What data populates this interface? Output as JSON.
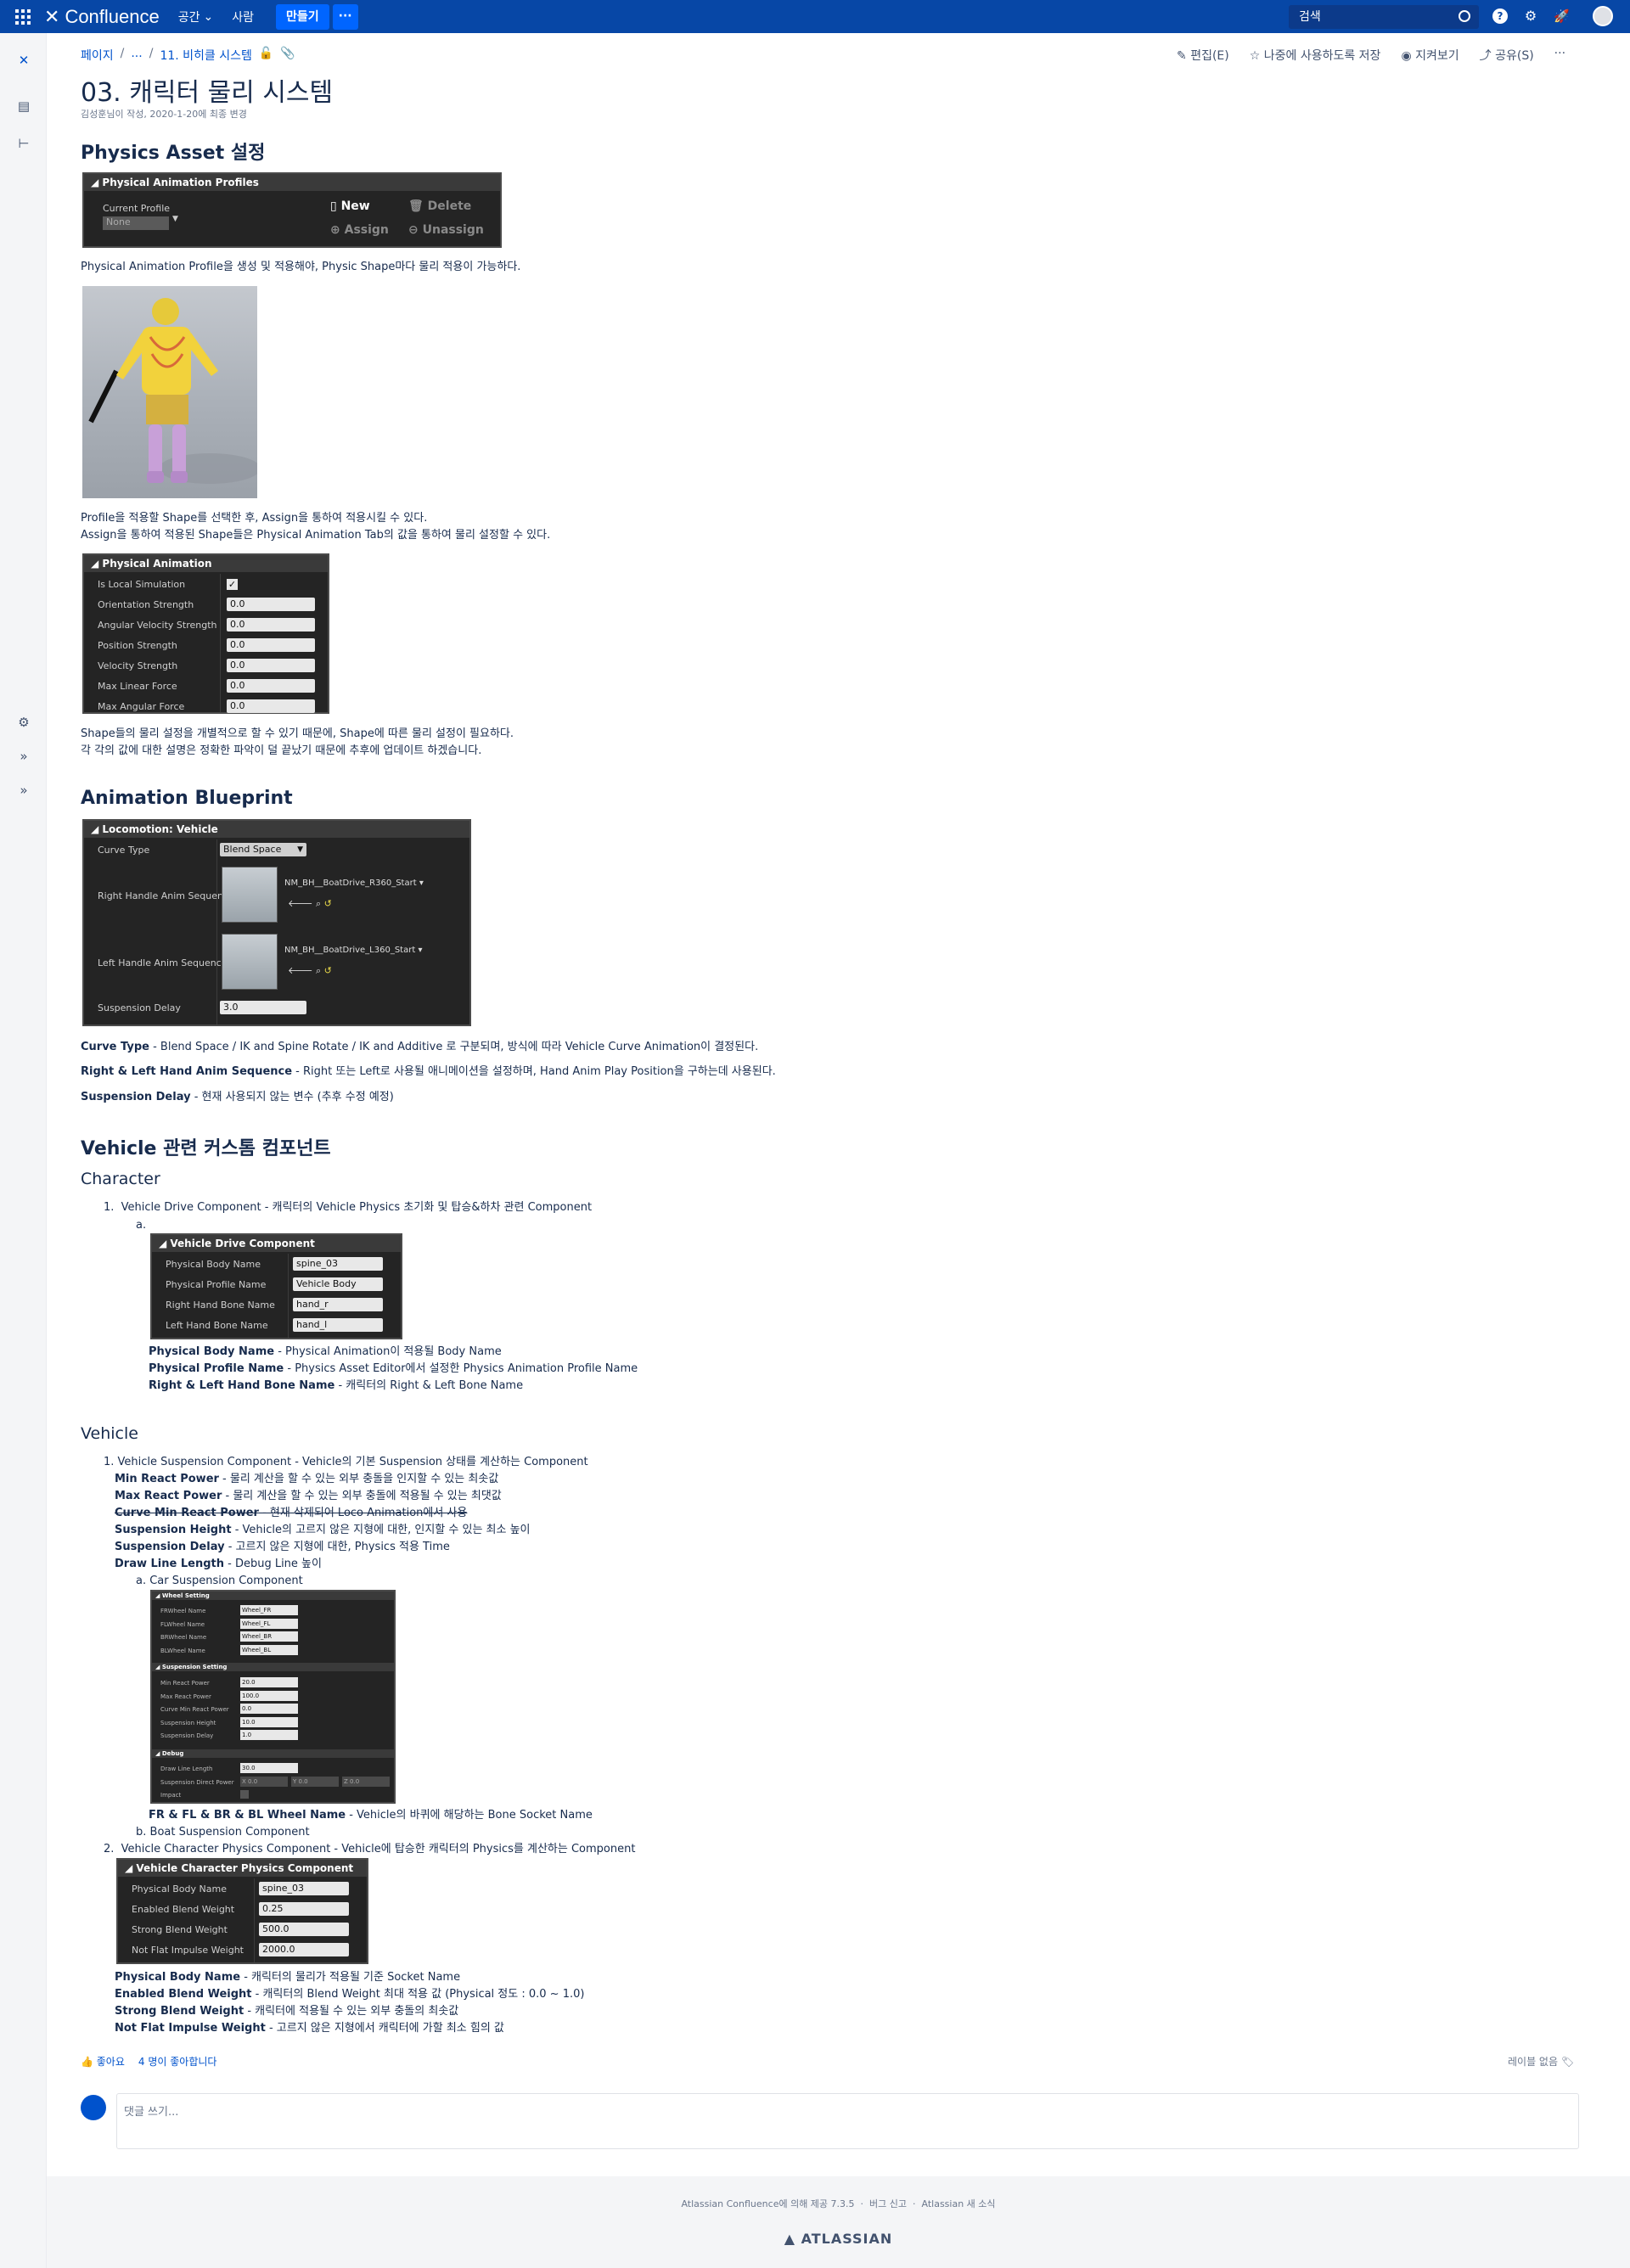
{
  "topnav": {
    "logo": "Confluence",
    "spaces": "공간",
    "people": "사람",
    "create": "만들기",
    "more": "···",
    "search_placeholder": "검색"
  },
  "breadcrumb": {
    "root": "페이지",
    "ellipsis": "...",
    "parent": "11. 비히클 시스템"
  },
  "actions": {
    "edit": "편집(E)",
    "save_later": "나중에 사용하도록 저장",
    "watch": "지켜보기",
    "share": "공유(S)",
    "more": "···"
  },
  "page": {
    "title": "03. 캐릭터 물리 시스템",
    "byline": "김성훈님이 작성, 2020-1-20에 최종 변경"
  },
  "sections": {
    "physics_asset": {
      "heading": "Physics Asset 설정",
      "profiles_panel": {
        "title": "Physical Animation Profiles",
        "current_profile_label": "Current Profile",
        "current_profile_value": "None",
        "new": "New",
        "delete": "Delete",
        "assign": "Assign",
        "unassign": "Unassign"
      },
      "text1": "Physical Animation Profile을 생성 및 적용해야, Physic Shape마다 물리 적용이 가능하다.",
      "text2": "Profile을 적용할 Shape를 선택한 후, Assign을 통하여 적용시킬 수 있다.",
      "text3": "Assign을 통하여 적용된 Shape들은 Physical Animation Tab의 값을 통하여 물리 설정할 수 있다.",
      "pa_panel": {
        "title": "Physical Animation",
        "rows": [
          {
            "label": "Is Local Simulation",
            "value": ""
          },
          {
            "label": "Orientation Strength",
            "value": "0.0"
          },
          {
            "label": "Angular Velocity Strength",
            "value": "0.0"
          },
          {
            "label": "Position Strength",
            "value": "0.0"
          },
          {
            "label": "Velocity Strength",
            "value": "0.0"
          },
          {
            "label": "Max Linear Force",
            "value": "0.0"
          },
          {
            "label": "Max Angular Force",
            "value": "0.0"
          }
        ]
      },
      "text4": "Shape들의 물리 설정을 개별적으로 할 수 있기 때문에, Shape에 따른 물리 설정이 필요하다.",
      "text5": "각 각의 값에 대한 설명은 정확한 파악이 덜 끝났기 때문에 추후에 업데이트 하겠습니다."
    },
    "anim_bp": {
      "heading": "Animation Blueprint",
      "panel": {
        "title": "Locomotion: Vehicle",
        "curve_type_label": "Curve Type",
        "curve_type_value": "Blend Space",
        "right_label": "Right Handle Anim Sequenc",
        "right_value": "NM_BH__BoatDrive_R360_Start",
        "left_label": "Left Handle Anim Sequence",
        "left_value": "NM_BH__BoatDrive_L360_Start",
        "delay_label": "Suspension Delay",
        "delay_value": "3.0"
      },
      "d1_term": "Curve Type",
      "d1_desc": " - Blend Space / IK and Spine Rotate / IK and Additive 로 구분되며, 방식에 따라 Vehicle Curve Animation이 결정된다.",
      "d2_term": "Right & Left Hand Anim Sequence",
      "d2_desc": " - Right 또는 Left로 사용될 애니메이션을 설정하며, Hand Anim Play Position을 구하는데 사용된다.",
      "d3_term": "Suspension Delay",
      "d3_desc": " - 현재 사용되지 않는 변수 (추후 수정 예정)"
    },
    "vehicle_components": {
      "heading": "Vehicle 관련 커스톰 컴포넌트",
      "character_heading": "Character",
      "char_item1": "Vehicle Drive Component - 캐릭터의 Vehicle Physics 초기화 및 탑승&하차 관련 Component",
      "char_sub_a": "a.",
      "vdc_panel": {
        "title": "Vehicle Drive Component",
        "rows": [
          {
            "label": "Physical Body Name",
            "value": "spine_03"
          },
          {
            "label": "Physical Profile Name",
            "value": "Vehicle Body"
          },
          {
            "label": "Right Hand Bone Name",
            "value": "hand_r"
          },
          {
            "label": "Left Hand Bone Name",
            "value": "hand_l"
          }
        ]
      },
      "vdc_d1_term": "Physical Body Name",
      "vdc_d1_desc": " - Physical Animation이 적용될 Body Name",
      "vdc_d2_term": "Physical Profile Name",
      "vdc_d2_desc": " - Physics Asset Editor에서 설정한 Physics Animation Profile Name",
      "vdc_d3_term": "Right & Left Hand Bone Name",
      "vdc_d3_desc": " - 캐릭터의 Right & Left Bone Name",
      "vehicle_heading": "Vehicle",
      "veh_item1": "Vehicle Suspension Component - Vehicle의 기본 Suspension 상태를 계산하는 Component",
      "vs_d1_term": "Min React Power",
      "vs_d1_desc": " - 물리 계산을 할 수 있는 외부 충돌을 인지할 수 있는 최솟값",
      "vs_d2_term": "Max React Power",
      "vs_d2_desc": " - 물리 계산을 할 수 있는 외부 충돌에 적용될 수 있는 최댓값",
      "vs_d3_term": "Curve Min React Power",
      "vs_d3_desc": " - 현재 삭제되어 Loco Animation에서 사용",
      "vs_d4_term": "Suspension Height",
      "vs_d4_desc": " - Vehicle의 고르지 않은 지형에 대한, 인지할 수 있는 최소 높이",
      "vs_d5_term": "Suspension Delay",
      "vs_d5_desc": " - 고르지 않은 지형에 대한, Physics 적용 Time",
      "vs_d6_term": "Draw Line Length",
      "vs_d6_desc": " - Debug Line 높이",
      "car_susp": "Car Suspension Component",
      "small_panel": {
        "wheel_setting": "Wheel Setting",
        "wheel_rows": [
          {
            "label": "FRWheel Name",
            "value": "Wheel_FR"
          },
          {
            "label": "FLWheel Name",
            "value": "Wheel_FL"
          },
          {
            "label": "BRWheel Name",
            "value": "Wheel_BR"
          },
          {
            "label": "BLWheel Name",
            "value": "Wheel_BL"
          }
        ],
        "susp_setting": "Suspension Setting",
        "susp_rows": [
          {
            "label": "Min React Power",
            "value": "20.0"
          },
          {
            "label": "Max React Power",
            "value": "100.0"
          },
          {
            "label": "Curve Min React Power",
            "value": "0.0"
          },
          {
            "label": "Suspension Height",
            "value": "10.0"
          },
          {
            "label": "Suspension Delay",
            "value": "1.0"
          }
        ],
        "debug": "Debug",
        "debug_rows": [
          {
            "label": "Draw Line Length",
            "value": "30.0"
          },
          {
            "label": "Suspension Direct Power",
            "value": "X 0.0"
          },
          {
            "label": "Impact",
            "value": ""
          }
        ],
        "y_val": "Y 0.0",
        "z_val": "Z 0.0"
      },
      "wheel_term": "FR & FL & BR & BL Wheel Name",
      "wheel_desc": " - Vehicle의 바퀴에 해당하는 Bone Socket Name",
      "boat_susp": "Boat Suspension Component",
      "veh_item2": "Vehicle Character Physics Component - Vehicle에 탑승한 캐릭터의 Physics를 계산하는 Component",
      "vcp_panel": {
        "title": "Vehicle Character Physics Component",
        "rows": [
          {
            "label": "Physical Body Name",
            "value": "spine_03"
          },
          {
            "label": "Enabled Blend Weight",
            "value": "0.25"
          },
          {
            "label": "Strong Blend Weight",
            "value": "500.0"
          },
          {
            "label": "Not Flat Impulse Weight",
            "value": "2000.0"
          }
        ]
      },
      "vcp_d1_term": "Physical Body Name",
      "vcp_d1_desc": " - 캐릭터의 물리가 적용될 기준 Socket Name",
      "vcp_d2_term": "Enabled Blend Weight",
      "vcp_d2_desc": " - 캐릭터의 Blend Weight 최대 적용 값 (Physical 정도 : 0.0 ~ 1.0)",
      "vcp_d3_term": "Strong Blend Weight",
      "vcp_d3_desc": " - 캐릭터에 적용될 수 있는 외부 충돌의 최솟값",
      "vcp_d4_term": "Not Flat Impulse Weight",
      "vcp_d4_desc": " - 고르지 않은 지형에서 캐릭터에 가할 최소 힘의 값"
    }
  },
  "feedback": {
    "like": "좋아요",
    "like_count": "4 명이 좋아합니다",
    "labels": "레이블 없음",
    "comment_placeholder": "댓글 쓰기..."
  },
  "footer": {
    "powered": "Atlassian Confluence에 의해 제공 7.3.5",
    "report": "버그 신고",
    "news": "Atlassian 새 소식",
    "brand": "ATLASSIAN"
  },
  "colors": {
    "nav": "#0747a6",
    "link": "#0052cc",
    "panel": "#242424",
    "text": "#172b4d"
  }
}
